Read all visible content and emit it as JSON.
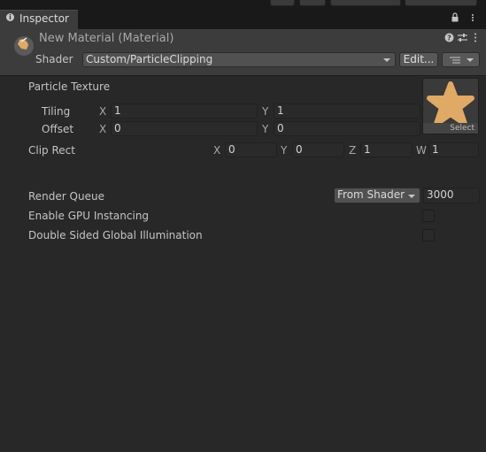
{
  "window": {
    "tab_label": "Inspector"
  },
  "header": {
    "material_title": "New Material (Material)",
    "shader_label": "Shader",
    "shader_value": "Custom/ParticleClipping",
    "edit_button_label": "Edit..."
  },
  "properties": {
    "particle_texture_label": "Particle Texture",
    "texture_select_label": "Select",
    "tiling": {
      "label": "Tiling",
      "x_axis": "X",
      "x_value": "1",
      "y_axis": "Y",
      "y_value": "1"
    },
    "offset": {
      "label": "Offset",
      "x_axis": "X",
      "x_value": "0",
      "y_axis": "Y",
      "y_value": "0"
    },
    "clip_rect": {
      "label": "Clip Rect",
      "x_axis": "X",
      "x_value": "0",
      "y_axis": "Y",
      "y_value": "0",
      "z_axis": "Z",
      "z_value": "1",
      "w_axis": "W",
      "w_value": "1"
    }
  },
  "advanced": {
    "render_queue_label": "Render Queue",
    "render_queue_mode": "From Shader",
    "render_queue_value": "3000",
    "gpu_instancing_label": "Enable GPU Instancing",
    "gpu_instancing_checked": false,
    "double_sided_gi_label": "Double Sided Global Illumination",
    "double_sided_gi_checked": false
  },
  "colors": {
    "panel_bg": "#282828",
    "header_bg": "#3c3c3c",
    "texture_star": "#e0a965"
  }
}
